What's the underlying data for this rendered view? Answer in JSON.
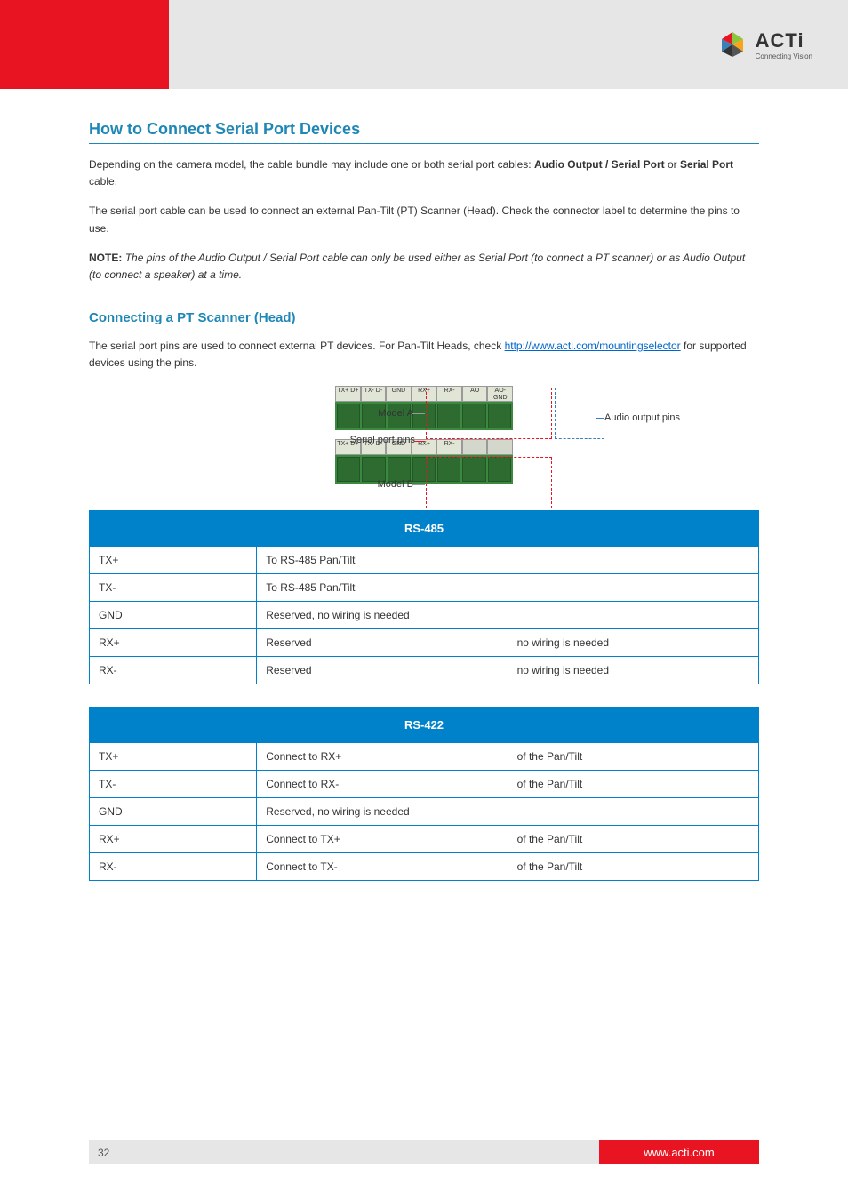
{
  "header": {
    "brand": "ACTi",
    "tagline": "Connecting Vision"
  },
  "sectionTitle": "How to Connect Serial Port Devices",
  "para1_a": "Depending on the camera model, the cable bundle may include one or both serial port cables: ",
  "para1_b": "Audio Output / Serial Port",
  "para1_c": " or ",
  "para1_d": "Serial Port",
  "para1_e": " cable.",
  "para2": "The serial port cable can be used to connect an external Pan-Tilt (PT) Scanner (Head). Check the connector label to determine the pins to use.",
  "note_a": "NOTE:",
  "note_b": " The pins of the Audio Output / Serial Port cable can only be used either as Serial Port (to connect a PT scanner) or as Audio Output (to connect a speaker) at a time.",
  "subsectionTitle": "Connecting a PT Scanner (Head)",
  "para3_a": "The serial port pins are used to connect external PT devices. For Pan-Tilt Heads, check ",
  "para3_b": "http://www.acti.com/mountingselector",
  "para3_c": " for supported devices using the pins.",
  "annotations": {
    "modelA": "Model A",
    "modelB": "Model B",
    "serialPins": "Serial port pins",
    "audioPins": "Audio output pins"
  },
  "terminalLabels": [
    "TX+ D+",
    "TX- D-",
    "GND",
    "RX+",
    "RX-",
    "AO",
    "AO-GND"
  ],
  "terminalLabelsB": [
    "TX+ D+",
    "TX- D-",
    "GND",
    "RX+",
    "RX-"
  ],
  "table1": {
    "header": "RS-485",
    "rows": [
      [
        "TX+",
        "To RS-485 Pan/Tilt"
      ],
      [
        "TX-",
        "To RS-485 Pan/Tilt"
      ],
      [
        "GND",
        "Reserved, no wiring is needed"
      ],
      [
        "RX+",
        "Reserved",
        "no wiring is needed"
      ],
      [
        "RX-",
        "Reserved",
        "no wiring is needed"
      ]
    ]
  },
  "table2": {
    "header": "RS-422",
    "rows": [
      [
        "TX+",
        "Connect to RX+",
        "of the Pan/Tilt"
      ],
      [
        "TX-",
        "Connect to RX-",
        "of the Pan/Tilt"
      ],
      [
        "GND",
        "Reserved, no wiring is needed"
      ],
      [
        "RX+",
        "Connect to TX+",
        "of the Pan/Tilt"
      ],
      [
        "RX-",
        "Connect to TX-",
        "of the Pan/Tilt"
      ]
    ]
  },
  "footer": {
    "page": "32",
    "url": "www.acti.com"
  }
}
